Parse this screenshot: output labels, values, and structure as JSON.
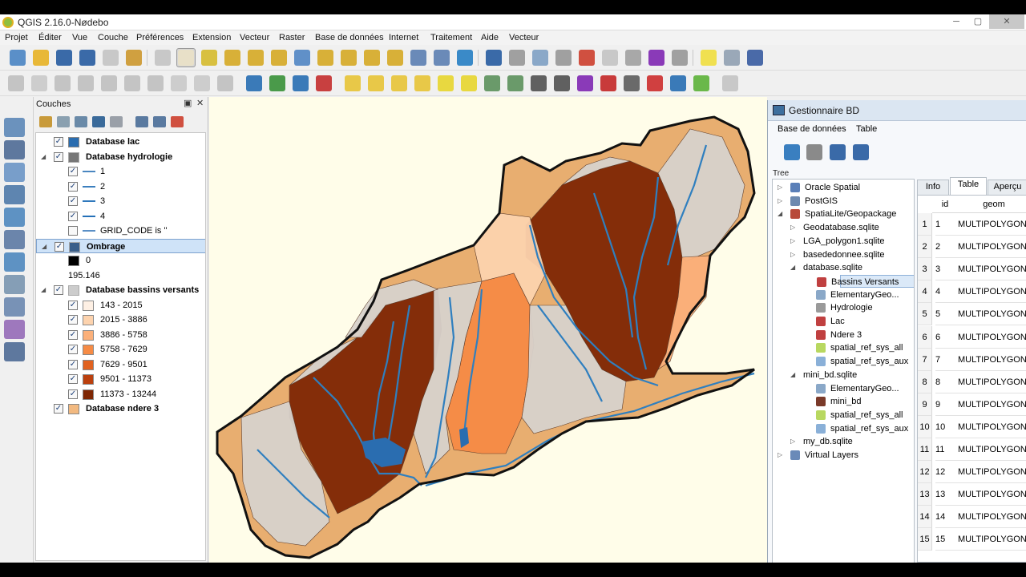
{
  "window": {
    "title": "QGIS 2.16.0-Nødebo",
    "minimize": "─",
    "maximize": "▢",
    "close": "✕"
  },
  "menu": [
    "Projet",
    "Éditer",
    "Vue",
    "Couche",
    "Préférences",
    "Extension",
    "Vecteur",
    "Raster",
    "Base de données",
    "Internet",
    "Traitement",
    "Aide",
    "Vecteur"
  ],
  "layers_panel": {
    "title": "Couches",
    "float_icon": "▣",
    "close_icon": "✕",
    "rows": [
      {
        "label": "Database lac",
        "bold": true,
        "check": "✓",
        "symbol": "square",
        "color": "#2a6db0",
        "indent": 0,
        "expand": ""
      },
      {
        "label": "Database hydrologie",
        "bold": true,
        "check": "✓",
        "symbol": "line-icon",
        "color": "#777777",
        "indent": 0,
        "expand": "◢"
      },
      {
        "label": "1",
        "bold": false,
        "check": "✓",
        "symbol": "line",
        "color": "#4a86c0",
        "indent": 1,
        "expand": ""
      },
      {
        "label": "2",
        "bold": false,
        "check": "✓",
        "symbol": "line",
        "color": "#3c7fbe",
        "indent": 1,
        "expand": ""
      },
      {
        "label": "3",
        "bold": false,
        "check": "✓",
        "symbol": "line",
        "color": "#2f78bc",
        "indent": 1,
        "expand": ""
      },
      {
        "label": "4",
        "bold": false,
        "check": "✓",
        "symbol": "line",
        "color": "#2470b8",
        "indent": 1,
        "expand": ""
      },
      {
        "label": "GRID_CODE is ''",
        "bold": false,
        "check": "",
        "symbol": "line",
        "color": "#5a8fc6",
        "indent": 1,
        "expand": ""
      },
      {
        "label": "Ombrage",
        "bold": true,
        "check": "✓",
        "symbol": "raster-icon",
        "color": "#3a5f8a",
        "indent": 0,
        "expand": "◢",
        "selected": true
      },
      {
        "label": "0",
        "bold": false,
        "check": "",
        "symbol": "square",
        "color": "#000000",
        "indent": 1,
        "expand": "",
        "nochk": true
      },
      {
        "label": "195.146",
        "bold": false,
        "check": "",
        "symbol": "none",
        "color": "#ffffff",
        "indent": 1,
        "expand": "",
        "nochk": true
      },
      {
        "label": "Database bassins versants",
        "bold": true,
        "check": "✓",
        "symbol": "poly-icon",
        "color": "#cccccc",
        "indent": 0,
        "expand": "◢"
      },
      {
        "label": "143 - 2015",
        "bold": false,
        "check": "✓",
        "symbol": "square",
        "color": "#fef0e4",
        "indent": 1,
        "expand": ""
      },
      {
        "label": "2015 - 3886",
        "bold": false,
        "check": "✓",
        "symbol": "square",
        "color": "#fdd3ae",
        "indent": 1,
        "expand": ""
      },
      {
        "label": "3886 - 5758",
        "bold": false,
        "check": "✓",
        "symbol": "square",
        "color": "#fbb07a",
        "indent": 1,
        "expand": ""
      },
      {
        "label": "5758 - 7629",
        "bold": false,
        "check": "✓",
        "symbol": "square",
        "color": "#f68b45",
        "indent": 1,
        "expand": ""
      },
      {
        "label": "7629 - 9501",
        "bold": false,
        "check": "✓",
        "symbol": "square",
        "color": "#e1621f",
        "indent": 1,
        "expand": ""
      },
      {
        "label": "9501 - 11373",
        "bold": false,
        "check": "✓",
        "symbol": "square",
        "color": "#bb400e",
        "indent": 1,
        "expand": ""
      },
      {
        "label": "11373 - 13244",
        "bold": false,
        "check": "✓",
        "symbol": "square",
        "color": "#7f2704",
        "indent": 1,
        "expand": ""
      },
      {
        "label": "Database ndere 3",
        "bold": true,
        "check": "✓",
        "symbol": "square",
        "color": "#f2b980",
        "indent": 0,
        "expand": ""
      }
    ]
  },
  "db_manager": {
    "title": "Gestionnaire BD",
    "menu": [
      "Base de données",
      "Table"
    ],
    "tree_label": "Tree",
    "tree": [
      {
        "label": "Oracle Spatial",
        "indent": 0,
        "expand": "▷",
        "icon": "#5a7fb8"
      },
      {
        "label": "PostGIS",
        "indent": 0,
        "expand": "▷",
        "icon": "#6d8ab0"
      },
      {
        "label": "SpatiaLite/Geopackage",
        "indent": 0,
        "expand": "◢",
        "icon": "#b84a3a"
      },
      {
        "label": "Geodatabase.sqlite",
        "indent": 1,
        "expand": "▷",
        "icon": ""
      },
      {
        "label": "LGA_polygon1.sqlite",
        "indent": 1,
        "expand": "▷",
        "icon": ""
      },
      {
        "label": "basededonnee.sqlite",
        "indent": 1,
        "expand": "▷",
        "icon": ""
      },
      {
        "label": "database.sqlite",
        "indent": 1,
        "expand": "◢",
        "icon": ""
      },
      {
        "label": "Bassins Versants",
        "indent": 2,
        "expand": "",
        "icon": "#c04040",
        "selected": true
      },
      {
        "label": "ElementaryGeo...",
        "indent": 2,
        "expand": "",
        "icon": "#8aa8c8"
      },
      {
        "label": "Hydrologie",
        "indent": 2,
        "expand": "",
        "icon": "#9a9a9a"
      },
      {
        "label": "Lac",
        "indent": 2,
        "expand": "",
        "icon": "#c04040"
      },
      {
        "label": "Ndere 3",
        "indent": 2,
        "expand": "",
        "icon": "#c04040"
      },
      {
        "label": "spatial_ref_sys_all",
        "indent": 2,
        "expand": "",
        "icon": "#b8d860"
      },
      {
        "label": "spatial_ref_sys_aux",
        "indent": 2,
        "expand": "",
        "icon": "#8ab0d8"
      },
      {
        "label": "mini_bd.sqlite",
        "indent": 1,
        "expand": "◢",
        "icon": ""
      },
      {
        "label": "ElementaryGeo...",
        "indent": 2,
        "expand": "",
        "icon": "#8aa8c8"
      },
      {
        "label": "mini_bd",
        "indent": 2,
        "expand": "",
        "icon": "#7a3a2a"
      },
      {
        "label": "spatial_ref_sys_all",
        "indent": 2,
        "expand": "",
        "icon": "#b8d860"
      },
      {
        "label": "spatial_ref_sys_aux",
        "indent": 2,
        "expand": "",
        "icon": "#8ab0d8"
      },
      {
        "label": "my_db.sqlite",
        "indent": 1,
        "expand": "▷",
        "icon": ""
      },
      {
        "label": "Virtual Layers",
        "indent": 0,
        "expand": "▷",
        "icon": "#6a8ab8"
      }
    ],
    "tabs": [
      "Info",
      "Table",
      "Aperçu"
    ],
    "active_tab": "Table",
    "columns": [
      "id",
      "geom"
    ],
    "rows": [
      {
        "n": "1",
        "id": "1",
        "geom": "MULTIPOLYGON"
      },
      {
        "n": "2",
        "id": "2",
        "geom": "MULTIPOLYGON"
      },
      {
        "n": "3",
        "id": "3",
        "geom": "MULTIPOLYGON"
      },
      {
        "n": "4",
        "id": "4",
        "geom": "MULTIPOLYGON"
      },
      {
        "n": "5",
        "id": "5",
        "geom": "MULTIPOLYGON"
      },
      {
        "n": "6",
        "id": "6",
        "geom": "MULTIPOLYGON"
      },
      {
        "n": "7",
        "id": "7",
        "geom": "MULTIPOLYGON"
      },
      {
        "n": "8",
        "id": "8",
        "geom": "MULTIPOLYGON"
      },
      {
        "n": "9",
        "id": "9",
        "geom": "MULTIPOLYGON"
      },
      {
        "n": "10",
        "id": "10",
        "geom": "MULTIPOLYGON"
      },
      {
        "n": "11",
        "id": "11",
        "geom": "MULTIPOLYGON"
      },
      {
        "n": "12",
        "id": "12",
        "geom": "MULTIPOLYGON"
      },
      {
        "n": "13",
        "id": "13",
        "geom": "MULTIPOLYGON"
      },
      {
        "n": "14",
        "id": "14",
        "geom": "MULTIPOLYGON"
      },
      {
        "n": "15",
        "id": "15",
        "geom": "MULTIPOLYGON"
      }
    ]
  },
  "toolbar1_icons": [
    "new-project-icon",
    "open-project-icon",
    "save-project-icon",
    "save-as-icon",
    "new-print-composer-icon",
    "composer-manager-icon",
    "pan-to-selection-icon",
    "pan-map-icon",
    "pan-map-arrows-icon",
    "zoom-in-icon",
    "zoom-out-icon",
    "zoom-native-icon",
    "zoom-full-icon",
    "zoom-to-selection-icon",
    "zoom-to-layer-icon",
    "zoom-last-icon",
    "zoom-next-icon",
    "new-map-view-icon",
    "bookmark-icon",
    "refresh-icon",
    "identify-icon",
    "action-icon",
    "select-icon",
    "select-by-value-icon",
    "deselect-icon",
    "attribute-table-icon",
    "field-calculator-icon",
    "statistics-icon",
    "measure-icon",
    "annotation-icon",
    "text-annotation-icon",
    "help-icon"
  ],
  "toolbar2_icons": [
    "digitize-icon",
    "pencil-icon",
    "save-edits-icon",
    "add-feature-icon",
    "add-part-icon",
    "node-tool-icon",
    "delete-icon",
    "cut-icon",
    "copy-icon",
    "label-icon",
    "python-icon",
    "globe-icon",
    "plugin-icon",
    "abc-icon",
    "bar-chart-icon",
    "bar-chart-2-icon",
    "bar-chart-3-icon",
    "bar-chart-4-icon",
    "sun-add-icon",
    "sun-add-2-icon",
    "bubble-add-icon",
    "bubble-add-2-icon",
    "grid-icon",
    "raster-calc-icon",
    "sigma-icon",
    "crosshair-icon",
    "pin-icon",
    "vector-icon",
    "satellite-icon",
    "plugin-puzzle-icon",
    "tip-icon"
  ],
  "vertical_icons": [
    "add-vector-icon",
    "add-raster-icon",
    "add-spatialite-icon",
    "add-mssql-icon",
    "add-wms-icon",
    "add-wcs-icon",
    "add-wfs-icon",
    "add-delimited-icon",
    "add-virtual-icon",
    "add-oracle-icon",
    "add-db2-icon"
  ],
  "map": {
    "background": "#fffde9",
    "palette": [
      "#fef0e4",
      "#fdd3ae",
      "#fbb07a",
      "#f68b45",
      "#e1621f",
      "#bb400e",
      "#7f2704",
      "#d8d2cc",
      "#e8ae70"
    ],
    "river_color": "#2f7fbf",
    "outline_color": "#111111"
  },
  "colors": {
    "accent": "#2f7fbf",
    "selection": "#cfe3f8"
  }
}
